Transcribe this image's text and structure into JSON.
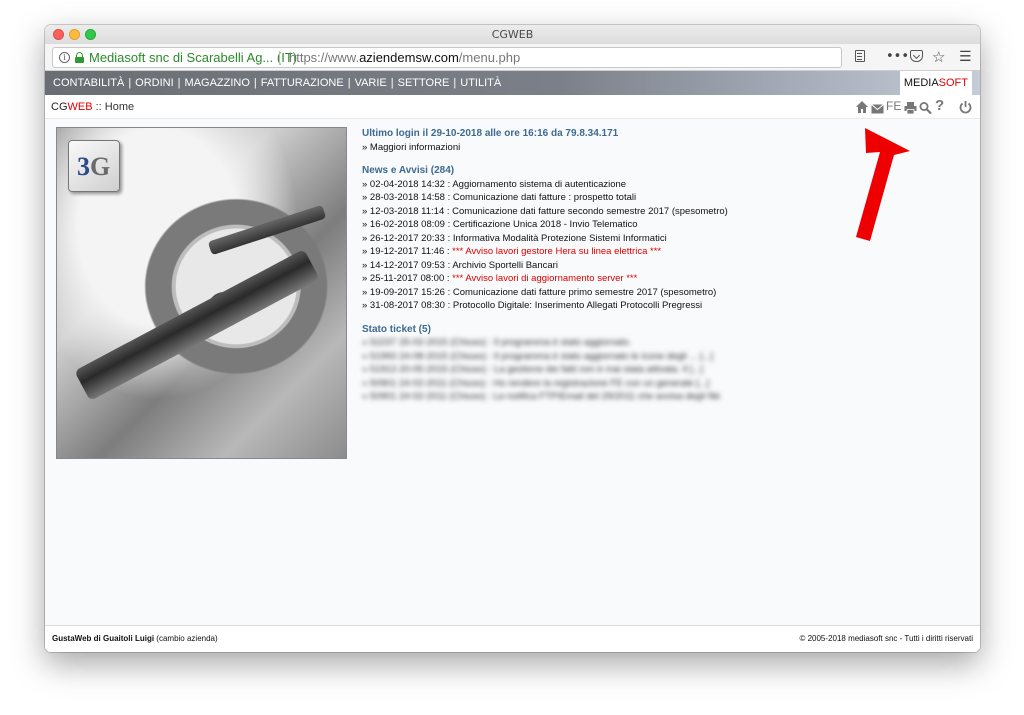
{
  "window": {
    "title": "CGWEB"
  },
  "browser": {
    "identity": "Mediasoft snc di Scarabelli Ag... (IT)",
    "url_prefix": "https://www.",
    "url_domain": "aziendemsw.com",
    "url_path": "/menu.php",
    "more_label": "•••",
    "star_label": "☆",
    "menu_label": "☰"
  },
  "menu": {
    "items": [
      "CONTABILITÀ",
      "ORDINI",
      "MAGAZZINO",
      "FATTURAZIONE",
      "VARIE",
      "SETTORE",
      "UTILITÀ"
    ],
    "separator": "|",
    "brand_part1": "MEDIA",
    "brand_part2": "SOFT"
  },
  "subbar": {
    "app_part1": "CG",
    "app_part2": "WEB",
    "crumb_sep": " :: ",
    "page": "Home",
    "icon_fe": "FE",
    "icon_help": "?"
  },
  "main": {
    "last_login": "Ultimo login il 29-10-2018 alle ore 16:16 da 79.8.34.171",
    "more_info": "» Maggiori informazioni",
    "news_title": "News e Avvisi (284)",
    "news": [
      {
        "date": "» 02-04-2018 14:32 : ",
        "text": "Aggiornamento sistema di autenticazione",
        "highlight": false
      },
      {
        "date": "» 28-03-2018 14:58 : ",
        "text": "Comunicazione dati fatture : prospetto totali",
        "highlight": false
      },
      {
        "date": "» 12-03-2018 11:14 : ",
        "text": "Comunicazione dati fatture secondo semestre 2017 (spesometro)",
        "highlight": false
      },
      {
        "date": "» 16-02-2018 08:09 : ",
        "text": "Certificazione Unica 2018 - Invio Telematico",
        "highlight": false
      },
      {
        "date": "» 26-12-2017 20:33 : ",
        "text": "Informativa Modalità Protezione Sistemi Informatici",
        "highlight": false
      },
      {
        "date": "» 19-12-2017 11:46 : ",
        "text": "*** Avviso lavori gestore Hera su linea elettrica ***",
        "highlight": true
      },
      {
        "date": "» 14-12-2017 09:53 : ",
        "text": "Archivio Sportelli Bancari",
        "highlight": false
      },
      {
        "date": "» 25-11-2017 08:00 : ",
        "text": "*** Avviso lavori di aggiornamento server ***",
        "highlight": true
      },
      {
        "date": "» 19-09-2017 15:26 : ",
        "text": "Comunicazione dati fatture primo semestre 2017 (spesometro)",
        "highlight": false
      },
      {
        "date": "» 31-08-2017 08:30 : ",
        "text": "Protocollo Digitale: Inserimento Allegati Protocolli Pregressi",
        "highlight": false
      }
    ],
    "tickets_title": "Stato ticket (5)",
    "tickets": [
      "» 52237 25-02-2015 (Chiuso) : Il programma è stato aggiornato.",
      "» 51993 24-08-2015 (Chiuso) : Il programma è stato aggiornato le icone degli ... [...]",
      "» 51913 20-05-2015 (Chiuso) : La gestione dei fatti non è mai stata attivata. Il [...]",
      "» 50901 24-02-2011 (Chiuso) : Ho rendere la registrazione FE con un generale [...]",
      "» 50901 24-02-2011 (Chiuso) : La notifica FTP/Email del 29/2011 che avvisa degli file"
    ]
  },
  "footer": {
    "left_bold": "GustaWeb di Guaitoli Luigi",
    "left_link": " (cambio azienda)",
    "right": "© 2005-2018 mediasoft snc - Tutti i diritti riservati"
  },
  "colors": {
    "accent_red": "#e00000",
    "section_blue": "#3d6a91"
  }
}
